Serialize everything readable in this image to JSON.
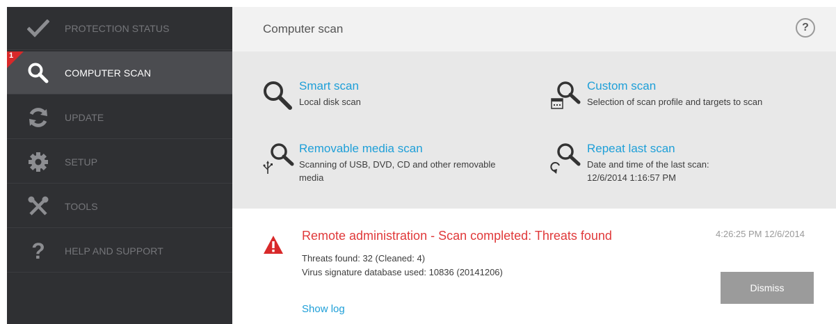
{
  "sidebar": {
    "items": [
      {
        "label": "PROTECTION STATUS",
        "icon": "checkmark-icon"
      },
      {
        "label": "COMPUTER SCAN",
        "icon": "magnifier-icon",
        "badge": "1"
      },
      {
        "label": "UPDATE",
        "icon": "refresh-icon"
      },
      {
        "label": "SETUP",
        "icon": "gear-icon"
      },
      {
        "label": "TOOLS",
        "icon": "tools-icon"
      },
      {
        "label": "HELP AND SUPPORT",
        "icon": "question-icon"
      }
    ]
  },
  "header": {
    "title": "Computer scan",
    "help": "?"
  },
  "scans": {
    "smart": {
      "title": "Smart scan",
      "desc": "Local disk scan"
    },
    "custom": {
      "title": "Custom scan",
      "desc": "Selection of scan profile and targets to scan"
    },
    "removable": {
      "title": "Removable media scan",
      "desc": "Scanning of USB, DVD, CD and other removable media"
    },
    "repeat": {
      "title": "Repeat last scan",
      "desc": "Date and time of the last scan: 12/6/2014 1:16:57 PM"
    }
  },
  "notification": {
    "title": "Remote administration - Scan completed: Threats found",
    "time": "4:26:25 PM 12/6/2014",
    "threats": "Threats found: 32 (Cleaned: 4)",
    "database": "Virus signature database used: 10836 (20141206)",
    "dismiss": "Dismiss",
    "show_log": "Show log"
  },
  "colors": {
    "sidebar_bg": "#2f3033",
    "sidebar_active": "#4b4c50",
    "accent_blue": "#1e9fd8",
    "alert_red": "#e0393a",
    "badge_red": "#d8292a"
  }
}
